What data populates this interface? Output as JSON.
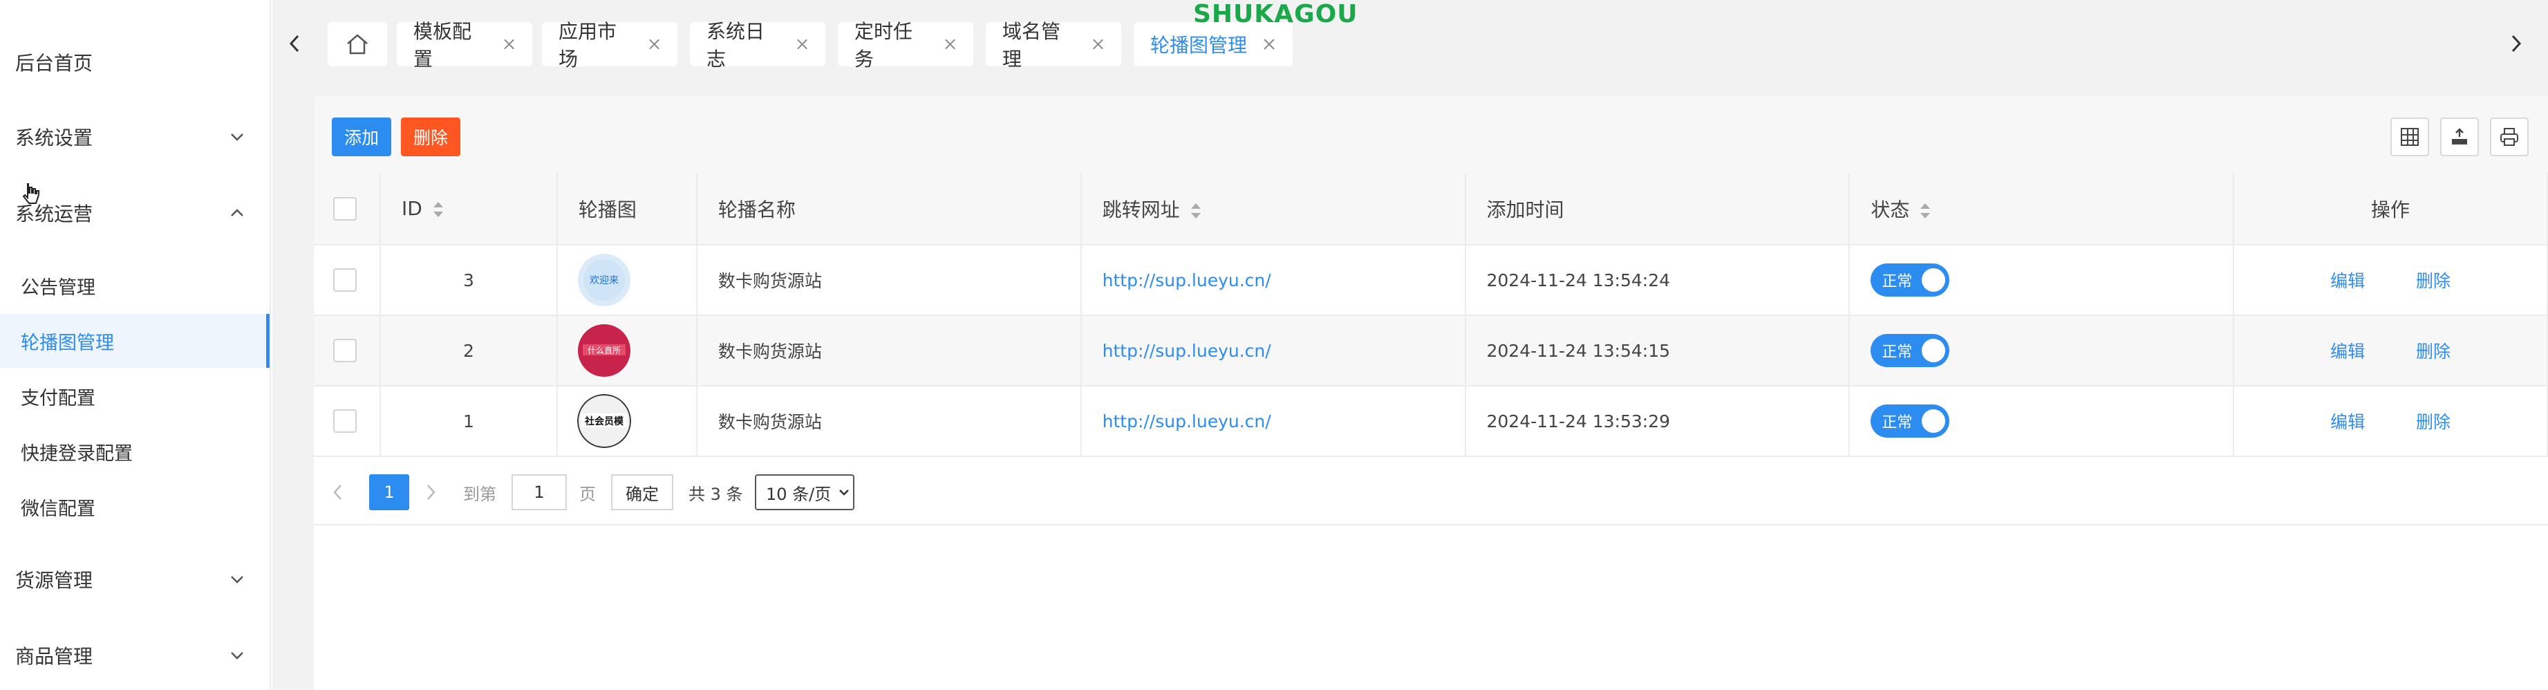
{
  "brand": "SHUKAGOU",
  "sidebar": {
    "home": "后台首页",
    "groups": [
      {
        "label": "系统设置",
        "expanded": false
      },
      {
        "label": "系统运营",
        "expanded": true
      },
      {
        "label": "货源管理",
        "expanded": false
      },
      {
        "label": "商品管理",
        "expanded": false
      }
    ],
    "sub_items": [
      {
        "label": "公告管理",
        "active": false
      },
      {
        "label": "轮播图管理",
        "active": true
      },
      {
        "label": "支付配置",
        "active": false
      },
      {
        "label": "快捷登录配置",
        "active": false
      },
      {
        "label": "微信配置",
        "active": false
      }
    ]
  },
  "tabs": [
    {
      "label": "模板配置"
    },
    {
      "label": "应用市场"
    },
    {
      "label": "系统日志"
    },
    {
      "label": "定时任务"
    },
    {
      "label": "域名管理"
    },
    {
      "label": "轮播图管理",
      "active": true
    }
  ],
  "toolbar": {
    "add_label": "添加",
    "delete_label": "删除"
  },
  "table": {
    "headers": {
      "id": "ID",
      "image": "轮播图",
      "name": "轮播名称",
      "url": "跳转网址",
      "time": "添加时间",
      "status": "状态",
      "ops": "操作"
    },
    "rows": [
      {
        "id": "3",
        "thumb_text": "欢迎来",
        "name": "数卡购货源站",
        "url": "http://sup.lueyu.cn/",
        "time": "2024-11-24 13:54:24",
        "status": "正常",
        "edit": "编辑",
        "delete": "删除"
      },
      {
        "id": "2",
        "thumb_text": "什么直所",
        "name": "数卡购货源站",
        "url": "http://sup.lueyu.cn/",
        "time": "2024-11-24 13:54:15",
        "status": "正常",
        "edit": "编辑",
        "delete": "删除"
      },
      {
        "id": "1",
        "thumb_text": "社会员模",
        "name": "数卡购货源站",
        "url": "http://sup.lueyu.cn/",
        "time": "2024-11-24 13:53:29",
        "status": "正常",
        "edit": "编辑",
        "delete": "删除"
      }
    ]
  },
  "pager": {
    "current_page": "1",
    "goto_label": "到第",
    "goto_value": "1",
    "page_unit": "页",
    "confirm_label": "确定",
    "total_label": "共 3 条",
    "page_size": "10 条/页"
  },
  "colors": {
    "accent": "#2d8cf0",
    "danger": "#ff5722",
    "brand": "#1aa84a"
  }
}
